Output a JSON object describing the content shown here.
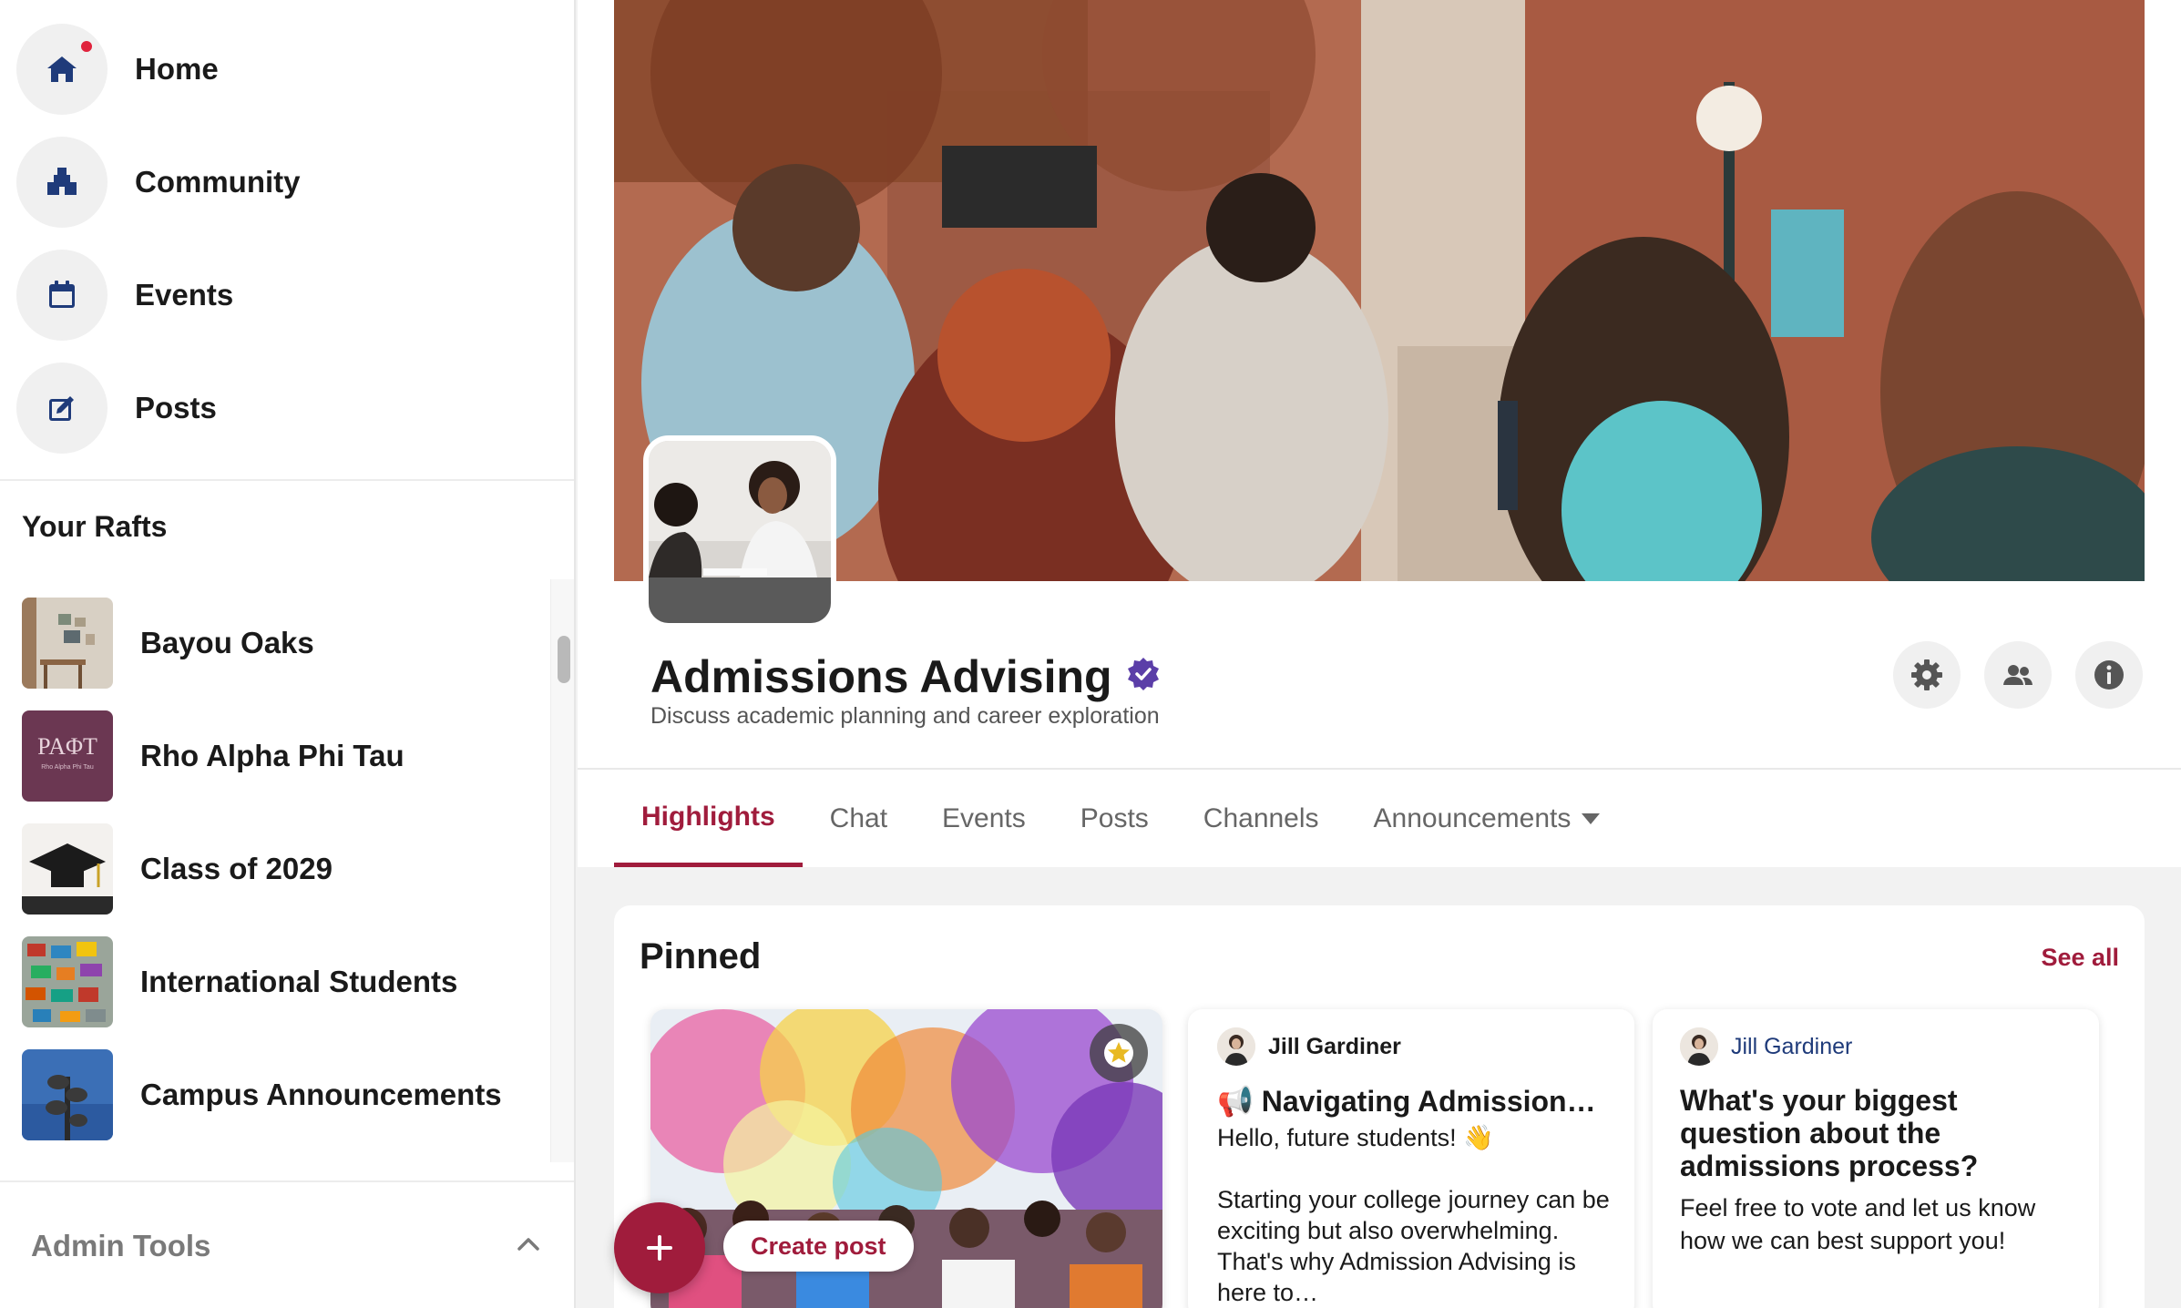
{
  "nav": {
    "items": [
      {
        "label": "Home",
        "icon": "home-icon",
        "notification": true
      },
      {
        "label": "Community",
        "icon": "community-icon",
        "notification": false
      },
      {
        "label": "Events",
        "icon": "calendar-icon",
        "notification": false
      },
      {
        "label": "Posts",
        "icon": "edit-post-icon",
        "notification": false
      }
    ]
  },
  "rafts": {
    "heading": "Your Rafts",
    "items": [
      {
        "name": "Bayou Oaks"
      },
      {
        "name": "Rho Alpha Phi Tau",
        "thumb_text": "PAΦT",
        "thumb_subtext": "Rho Alpha Phi Tau"
      },
      {
        "name": "Class of 2029"
      },
      {
        "name": "International Students"
      },
      {
        "name": "Campus Announcements"
      }
    ]
  },
  "admin_tools": {
    "label": "Admin Tools",
    "expanded": true
  },
  "group": {
    "title": "Admissions Advising",
    "verified": true,
    "description": "Discuss academic planning and career exploration",
    "actions": [
      {
        "icon": "settings-icon"
      },
      {
        "icon": "members-icon"
      },
      {
        "icon": "info-icon"
      }
    ]
  },
  "tabs": {
    "items": [
      {
        "label": "Highlights",
        "active": true
      },
      {
        "label": "Chat",
        "active": false
      },
      {
        "label": "Events",
        "active": false
      },
      {
        "label": "Posts",
        "active": false
      },
      {
        "label": "Channels",
        "active": false
      },
      {
        "label": "Announcements",
        "active": false,
        "dropdown": true
      }
    ]
  },
  "pinned": {
    "title": "Pinned",
    "see_all": "See all",
    "items": [
      {
        "type": "image",
        "starred": true
      },
      {
        "type": "post",
        "author": "Jill Gardiner",
        "title": "📢 Navigating Admission…",
        "body": "Hello, future students! 👋\n\nStarting your college journey can be exciting but also overwhelming. That's why Admission Advising is here to…"
      },
      {
        "type": "question",
        "author": "Jill Gardiner",
        "title": "What's your biggest question about the admissions process?",
        "body": "Feel free to vote and let us know how we can best support you!"
      }
    ]
  },
  "create_post": {
    "label": "Create post"
  },
  "colors": {
    "accent": "#a01c3c",
    "nav_icon": "#1f3b7a",
    "verified": "#5b3ea8",
    "notification": "#e0233c"
  }
}
